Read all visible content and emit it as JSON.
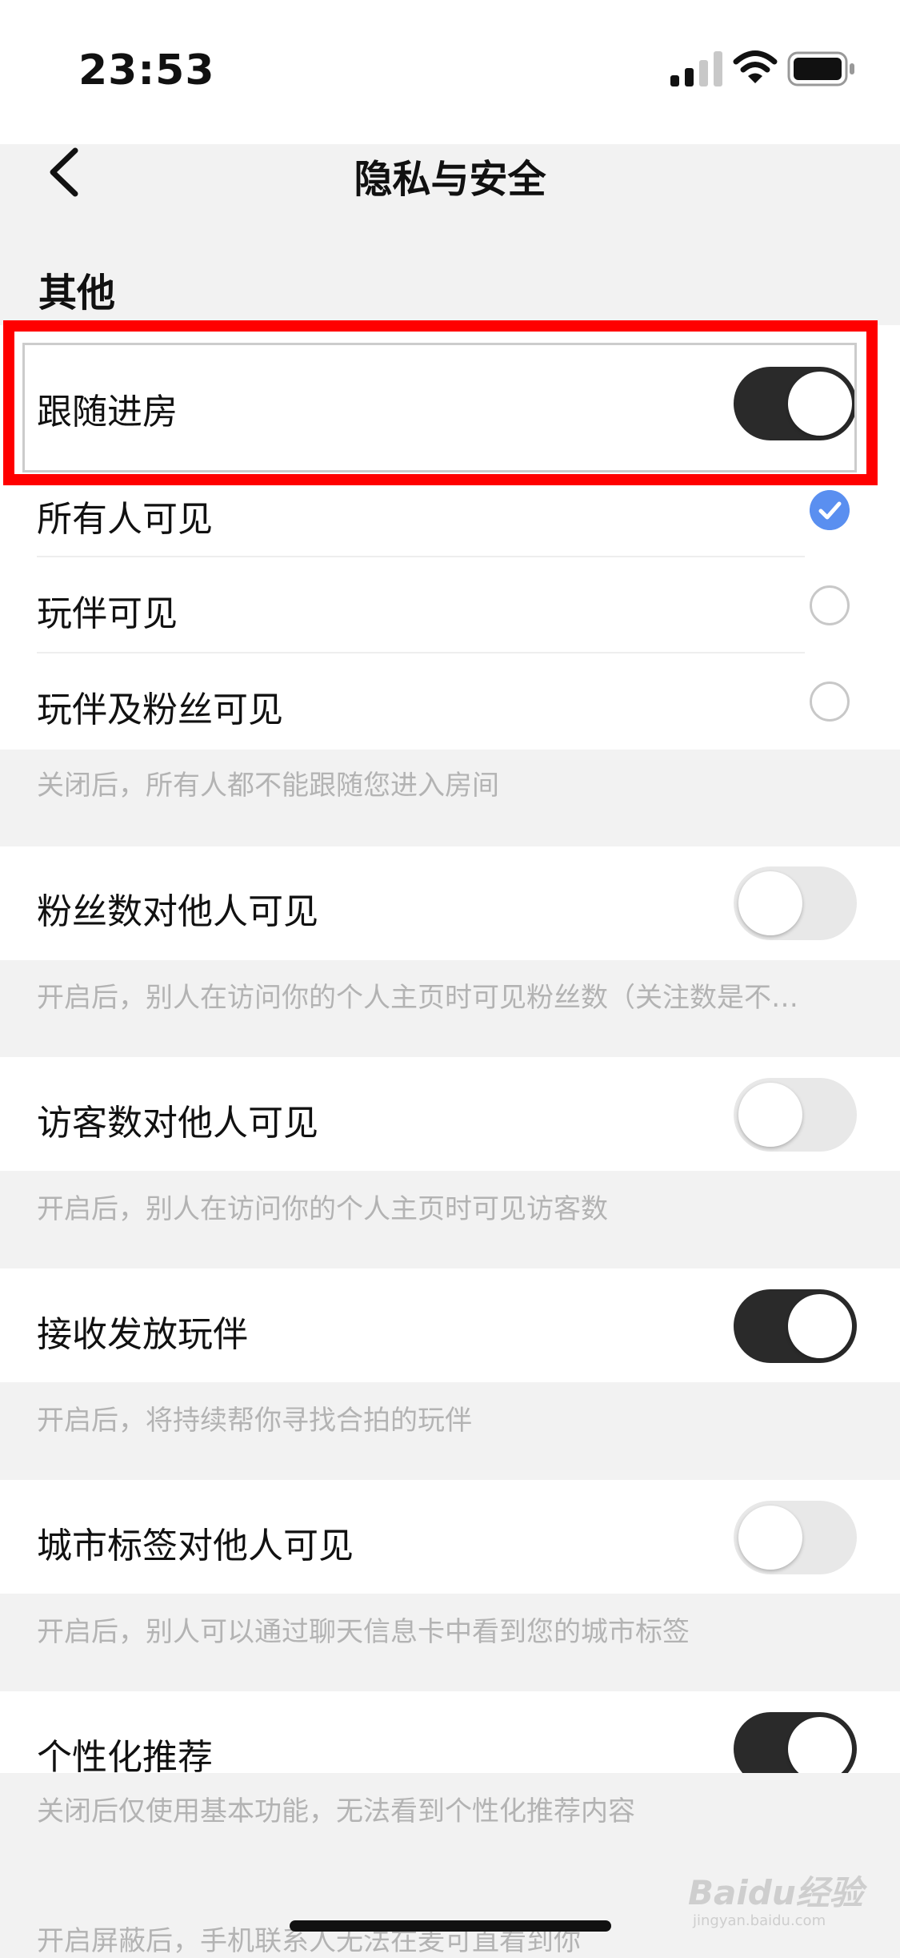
{
  "status_bar": {
    "time": "23:53"
  },
  "header": {
    "title": "隐私与安全"
  },
  "section": {
    "title": "其他"
  },
  "follow": {
    "label": "跟随进房",
    "enabled": true,
    "options": [
      {
        "label": "所有人可见",
        "selected": true
      },
      {
        "label": "玩伴可见",
        "selected": false
      },
      {
        "label": "玩伴及粉丝可见",
        "selected": false
      }
    ],
    "hint": "关闭后，所有人都不能跟随您进入房间"
  },
  "settings": [
    {
      "label": "粉丝数对他人可见",
      "enabled": false,
      "hint": "开启后，别人在访问你的个人主页时可见粉丝数（关注数是不…"
    },
    {
      "label": "访客数对他人可见",
      "enabled": false,
      "hint": "开启后，别人在访问你的个人主页时可见访客数"
    },
    {
      "label": "接收发放玩伴",
      "enabled": true,
      "hint": "开启后，将持续帮你寻找合拍的玩伴"
    },
    {
      "label": "城市标签对他人可见",
      "enabled": false,
      "hint": "开启后，别人可以通过聊天信息卡中看到您的城市标签"
    },
    {
      "label": "个性化推荐",
      "enabled": true,
      "hint": "关闭后仅使用基本功能，无法看到个性化推荐内容"
    }
  ],
  "bottom_hint": "开启屏蔽后，手机联系人无法在麦可直看到你",
  "watermark": {
    "text": "Baidu经验",
    "sub": "jingyan.baidu.com"
  },
  "colors": {
    "toggle_on": "#2a2a2a",
    "toggle_off": "#e8e8e8",
    "radio_selected": "#5a8ff0",
    "highlight": "#ff0000"
  }
}
